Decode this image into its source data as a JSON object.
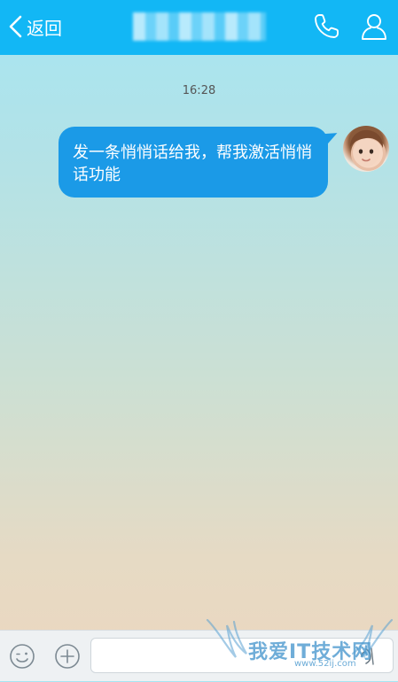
{
  "header": {
    "back_label": "返回",
    "title": "",
    "phone_icon": "phone-icon",
    "contact_icon": "person-icon",
    "bar_color": "#12b7f5"
  },
  "chat": {
    "timestamp": "16:28",
    "messages": [
      {
        "sender": "me",
        "text": "发一条悄悄话给我，帮我激活悄悄话功能",
        "bubble_color": "#1b9ae7"
      }
    ]
  },
  "input_bar": {
    "emoji_icon": "emoji-icon",
    "plus_icon": "plus-icon",
    "voice_icon": "voice-icon",
    "text_value": ""
  },
  "watermark": {
    "text": "我爱IT技术网",
    "sub": "www.52ij.com"
  }
}
